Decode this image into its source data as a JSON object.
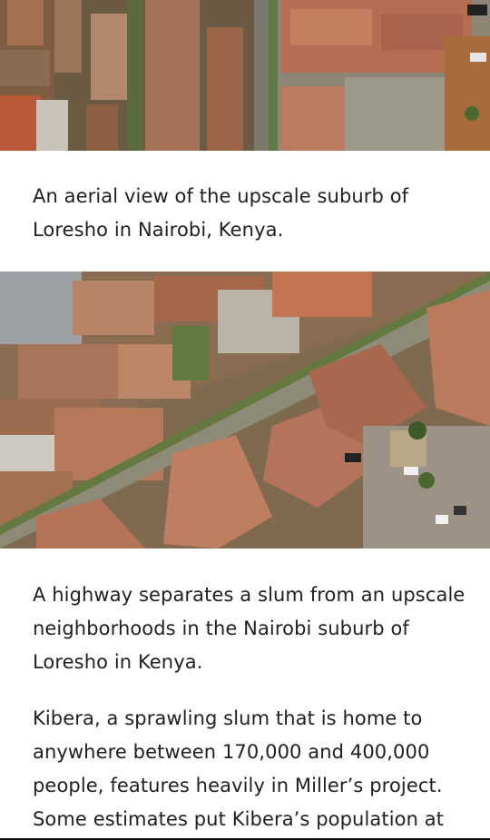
{
  "images": {
    "top": {
      "subject": "aerial view of slum and upscale housing"
    },
    "middle": {
      "subject": "aerial view of highway separating slum and upscale housing"
    }
  },
  "captions": {
    "first": "An aerial view of the upscale suburb of Loresho in Nairobi, Kenya.",
    "second": "A highway separates a slum from an upscale neighborhoods in the Nairobi suburb of Loresho in Kenya."
  },
  "article": {
    "paragraph": "Kibera, a sprawling slum that is home to anywhere between 170,000 and 400,000 people, features heavily in Miller’s project. Some estimates put Kibera’s population at"
  },
  "colors": {
    "rust_roof": "#a0623c",
    "terracotta_roof": "#b5705a",
    "road": "#8a8878",
    "vegetation": "#4f6b3a"
  }
}
